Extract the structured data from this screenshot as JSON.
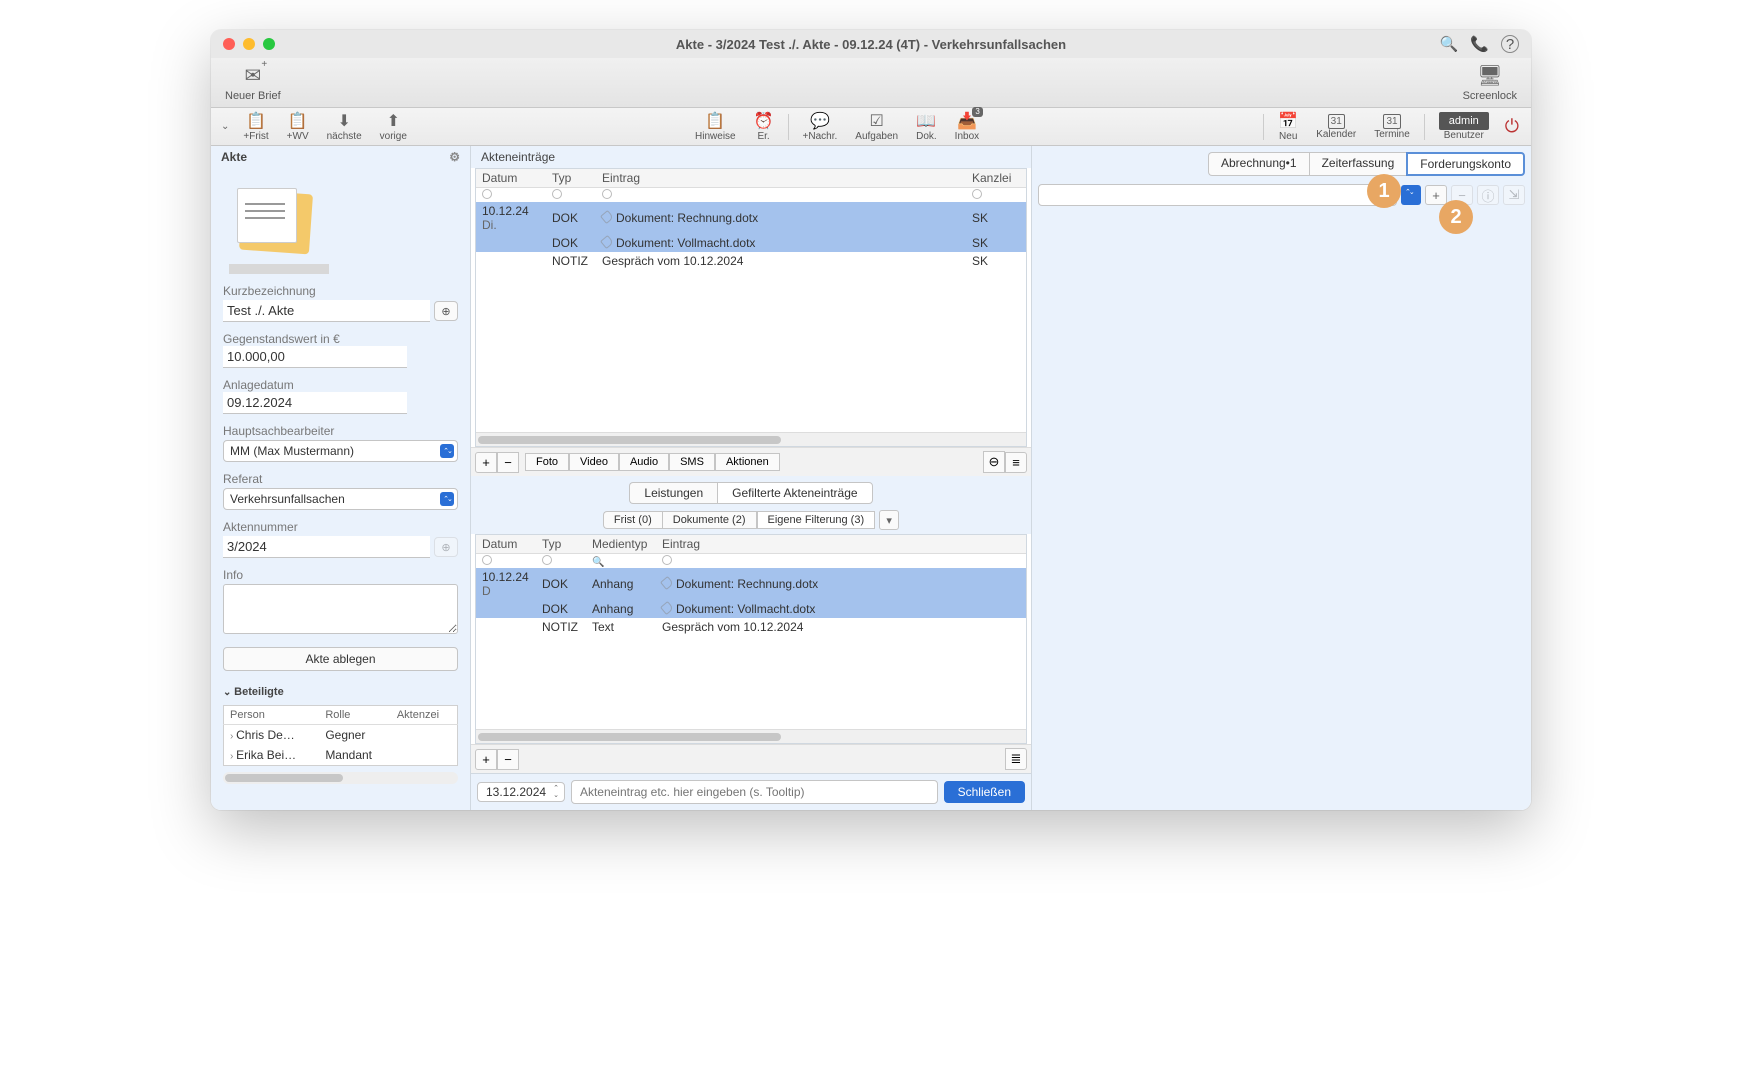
{
  "window": {
    "title": "Akte - 3/2024 Test ./. Akte - 09.12.24 (4T) - Verkehrsunfallsachen"
  },
  "toolbar1": {
    "neuer_brief": "Neuer Brief",
    "screenlock": "Screenlock"
  },
  "toolbar2": {
    "frist": "+Frist",
    "wv": "+WV",
    "naechste": "nächste",
    "vorige": "vorige",
    "hinweise": "Hinweise",
    "er": "Er.",
    "nachr": "+Nachr.",
    "aufgaben": "Aufgaben",
    "dok": "Dok.",
    "inbox": "Inbox",
    "inbox_badge": "3",
    "neu": "Neu",
    "kalender": "Kalender",
    "termine": "Termine",
    "user": "admin",
    "benutzer": "Benutzer"
  },
  "sidebar": {
    "header": "Akte",
    "kurz_label": "Kurzbezeichnung",
    "kurz_val": "Test ./. Akte",
    "gegen_label": "Gegenstandswert in €",
    "gegen_val": "10.000,00",
    "anlage_label": "Anlagedatum",
    "anlage_val": "09.12.2024",
    "haupt_label": "Hauptsachbearbeiter",
    "haupt_val": "MM (Max Mustermann)",
    "referat_label": "Referat",
    "referat_val": "Verkehrsunfallsachen",
    "aktnr_label": "Aktennummer",
    "aktnr_val": "3/2024",
    "info_label": "Info",
    "ablegen": "Akte ablegen",
    "beteiligte": "Beteiligte",
    "part_cols": {
      "person": "Person",
      "rolle": "Rolle",
      "aktenzei": "Aktenzei"
    },
    "parts": [
      {
        "person": "Chris De…",
        "rolle": "Gegner"
      },
      {
        "person": "Erika Bei…",
        "rolle": "Mandant"
      }
    ]
  },
  "center": {
    "header": "Akteneinträge",
    "cols": {
      "datum": "Datum",
      "typ": "Typ",
      "eintrag": "Eintrag",
      "kanzlei": "Kanzlei"
    },
    "rows": [
      {
        "datum": "10.12.24",
        "day": "Di.",
        "typ": "DOK",
        "eintrag": "Dokument: Rechnung.dotx",
        "kanzlei": "SK",
        "sel": true,
        "clip": true
      },
      {
        "datum": "",
        "day": "",
        "typ": "DOK",
        "eintrag": "Dokument: Vollmacht.dotx",
        "kanzlei": "SK",
        "sel": true,
        "clip": true
      },
      {
        "datum": "",
        "day": "",
        "typ": "NOTIZ",
        "eintrag": "Gespräch vom 10.12.2024",
        "kanzlei": "SK",
        "sel": false,
        "clip": false
      }
    ],
    "actions": {
      "foto": "Foto",
      "video": "Video",
      "audio": "Audio",
      "sms": "SMS",
      "aktionen": "Aktionen"
    },
    "seg1": {
      "leistungen": "Leistungen",
      "gefilterte": "Gefilterte Akteneinträge"
    },
    "seg2": {
      "frist": "Frist (0)",
      "dokumente": "Dokumente (2)",
      "eigene": "Eigene Filterung (3)"
    },
    "cols2": {
      "datum": "Datum",
      "typ": "Typ",
      "medientyp": "Medientyp",
      "eintrag": "Eintrag"
    },
    "rows2": [
      {
        "datum": "10.12.24",
        "d2": "D",
        "typ": "DOK",
        "medien": "Anhang",
        "eintrag": "Dokument: Rechnung.dotx",
        "sel": true,
        "clip": true
      },
      {
        "datum": "",
        "d2": "",
        "typ": "DOK",
        "medien": "Anhang",
        "eintrag": "Dokument: Vollmacht.dotx",
        "sel": true,
        "clip": true
      },
      {
        "datum": "",
        "d2": "",
        "typ": "NOTIZ",
        "medien": "Text",
        "eintrag": "Gespräch vom 10.12.2024",
        "sel": false,
        "clip": false
      }
    ],
    "bottom": {
      "date": "13.12.2024",
      "placeholder": "Akteneintrag etc. hier eingeben (s. Tooltip)",
      "close": "Schließen"
    }
  },
  "rightp": {
    "tabs": {
      "abrechnung": "Abrechnung•1",
      "zeiterfassung": "Zeiterfassung",
      "forderungskonto": "Forderungskonto"
    },
    "annot": {
      "n1": "1",
      "n2": "2"
    }
  }
}
